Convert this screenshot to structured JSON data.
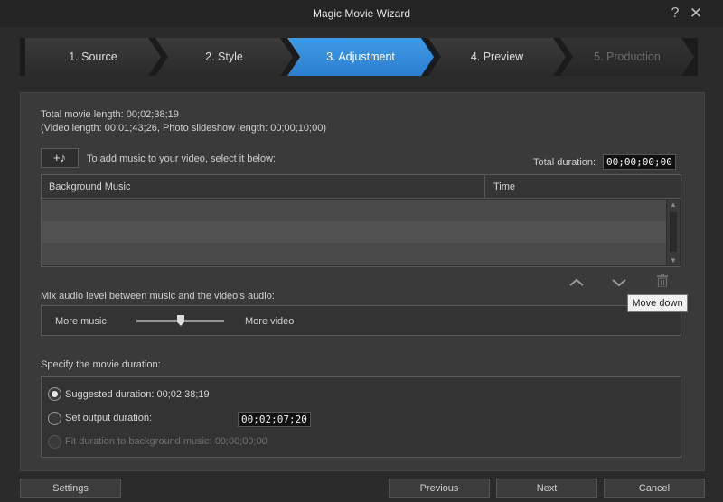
{
  "window": {
    "title": "Magic Movie Wizard",
    "help_glyph": "?",
    "close_glyph": "✕"
  },
  "steps": [
    {
      "label": "1. Source",
      "state": "inactive"
    },
    {
      "label": "2. Style",
      "state": "inactive"
    },
    {
      "label": "3. Adjustment",
      "state": "active"
    },
    {
      "label": "4. Preview",
      "state": "inactive"
    },
    {
      "label": "5. Production",
      "state": "disabled"
    }
  ],
  "info": {
    "total_length": "Total movie length: 00;02;38;19",
    "detail": "(Video length: 00;01;43;26, Photo slideshow length: 00;00;10;00)"
  },
  "music": {
    "add_button_glyph": "+♪",
    "prompt": "To add music to your video, select it below:",
    "total_duration_label": "Total duration:",
    "total_duration_value": "00;00;00;00",
    "columns": [
      "Background Music",
      "Time"
    ],
    "move_up_icon": "chevron-up",
    "move_down_icon": "chevron-down",
    "delete_icon": "trash"
  },
  "tooltip": "Move down",
  "mix": {
    "label": "Mix audio level between music and the video's audio:",
    "left_label": "More music",
    "right_label": "More video",
    "slider_value": 0.5
  },
  "duration": {
    "label": "Specify the movie duration:",
    "options": [
      {
        "label": "Suggested duration: 00;02;38;19",
        "checked": true,
        "enabled": true
      },
      {
        "label": "Set output duration:",
        "checked": false,
        "enabled": true
      },
      {
        "label": "Fit duration to background music: 00;00;00;00",
        "checked": false,
        "enabled": false
      }
    ],
    "output_value": "00;02;07;20"
  },
  "buttons": {
    "settings": "Settings",
    "previous": "Previous",
    "next": "Next",
    "cancel": "Cancel"
  },
  "colors": {
    "active_step": "#2c7fcf",
    "background": "#2b2b2b"
  }
}
